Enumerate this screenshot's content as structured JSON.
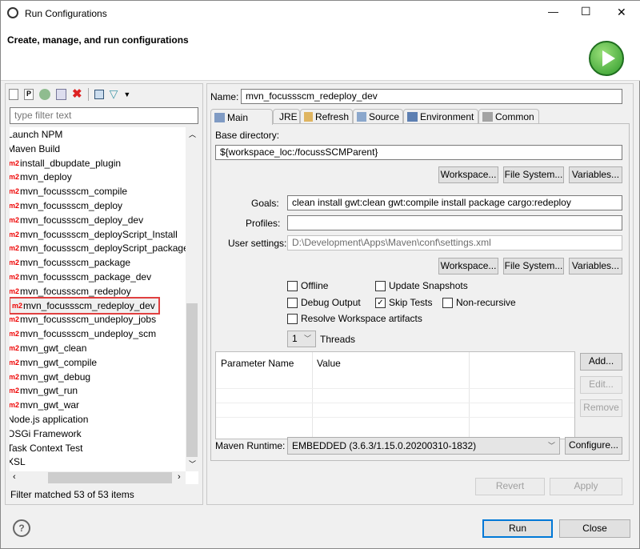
{
  "window": {
    "title": "Run Configurations",
    "minimize": "—",
    "maximize": "☐",
    "close": "✕"
  },
  "header": {
    "title": "Create, manage, and run configurations"
  },
  "left": {
    "filter_placeholder": "type filter text",
    "items": [
      {
        "label": "Launch NPM",
        "type": "category"
      },
      {
        "label": "Maven Build",
        "type": "category"
      },
      {
        "label": "install_dbupdate_plugin",
        "type": "m2"
      },
      {
        "label": "mvn_deploy",
        "type": "m2"
      },
      {
        "label": "mvn_focussscm_compile",
        "type": "m2"
      },
      {
        "label": "mvn_focussscm_deploy",
        "type": "m2"
      },
      {
        "label": "mvn_focussscm_deploy_dev",
        "type": "m2"
      },
      {
        "label": "mvn_focussscm_deployScript_Install",
        "type": "m2"
      },
      {
        "label": "mvn_focussscm_deployScript_package",
        "type": "m2"
      },
      {
        "label": "mvn_focussscm_package",
        "type": "m2"
      },
      {
        "label": "mvn_focussscm_package_dev",
        "type": "m2"
      },
      {
        "label": "mvn_focussscm_redeploy",
        "type": "m2"
      },
      {
        "label": "mvn_focussscm_redeploy_dev",
        "type": "m2",
        "selected": true
      },
      {
        "label": "mvn_focussscm_undeploy_jobs",
        "type": "m2"
      },
      {
        "label": "mvn_focussscm_undeploy_scm",
        "type": "m2"
      },
      {
        "label": "mvn_gwt_clean",
        "type": "m2"
      },
      {
        "label": "mvn_gwt_compile",
        "type": "m2"
      },
      {
        "label": "mvn_gwt_debug",
        "type": "m2"
      },
      {
        "label": "mvn_gwt_run",
        "type": "m2"
      },
      {
        "label": "mvn_gwt_war",
        "type": "m2"
      },
      {
        "label": "Node.js application",
        "type": "category"
      },
      {
        "label": "OSGi Framework",
        "type": "category"
      },
      {
        "label": "Task Context Test",
        "type": "category"
      },
      {
        "label": "XSL",
        "type": "category"
      }
    ],
    "m2_badge": "m2",
    "status": "Filter matched 53 of 53 items"
  },
  "right": {
    "name_label": "Name:",
    "name_value": "mvn_focussscm_redeploy_dev",
    "tabs": [
      "Main",
      "JRE",
      "Refresh",
      "Source",
      "Environment",
      "Common"
    ],
    "base_dir_label": "Base directory:",
    "base_dir_value": "${workspace_loc:/focussSCMParent}",
    "workspace_btn": "Workspace...",
    "filesystem_btn": "File System...",
    "variables_btn": "Variables...",
    "goals_label": "Goals:",
    "goals_value": "clean install gwt:clean gwt:compile install package cargo:redeploy",
    "profiles_label": "Profiles:",
    "profiles_value": "",
    "user_settings_label": "User settings:",
    "user_settings_value": "D:\\Development\\Apps\\Maven\\conf\\settings.xml",
    "checkboxes": {
      "offline": {
        "label": "Offline",
        "checked": false
      },
      "update_snapshots": {
        "label": "Update Snapshots",
        "checked": false
      },
      "debug_output": {
        "label": "Debug Output",
        "checked": false
      },
      "skip_tests": {
        "label": "Skip Tests",
        "checked": true
      },
      "non_recursive": {
        "label": "Non-recursive",
        "checked": false
      },
      "resolve_workspace": {
        "label": "Resolve Workspace artifacts",
        "checked": false
      }
    },
    "threads_value": "1",
    "threads_label": "Threads",
    "param_headers": [
      "Parameter Name",
      "Value"
    ],
    "add_btn": "Add...",
    "edit_btn": "Edit...",
    "remove_btn": "Remove",
    "runtime_label": "Maven Runtime:",
    "runtime_value": "EMBEDDED (3.6.3/1.15.0.20200310-1832)",
    "configure_btn": "Configure...",
    "revert_btn": "Revert",
    "apply_btn": "Apply"
  },
  "footer": {
    "help": "?",
    "run_btn": "Run",
    "close_btn": "Close"
  }
}
